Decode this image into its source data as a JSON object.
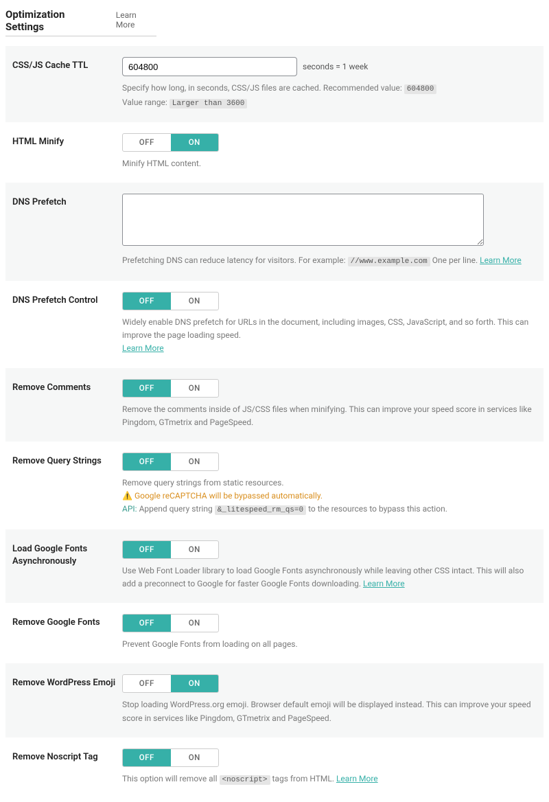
{
  "header": {
    "title": "Optimization Settings",
    "learn_more": "Learn More"
  },
  "settings": {
    "ttl": {
      "label": "CSS/JS Cache TTL",
      "value": "604800",
      "after": "seconds = 1 week",
      "desc1": "Specify how long, in seconds, CSS/JS files are cached. Recommended value:",
      "rec": "604800",
      "desc2": "Value range:",
      "range": "Larger than 3600"
    },
    "html_minify": {
      "label": "HTML Minify",
      "state": "on",
      "desc": "Minify HTML content."
    },
    "dns_prefetch": {
      "label": "DNS Prefetch",
      "value": "",
      "desc1": "Prefetching DNS can reduce latency for visitors. For example:",
      "example": "//www.example.com",
      "desc2": "One per line.",
      "learn": "Learn More"
    },
    "dns_prefetch_control": {
      "label": "DNS Prefetch Control",
      "state": "off",
      "desc": "Widely enable DNS prefetch for URLs in the document, including images, CSS, JavaScript, and so forth. This can improve the page loading speed.",
      "learn": "Learn More"
    },
    "remove_comments": {
      "label": "Remove Comments",
      "state": "off",
      "desc": "Remove the comments inside of JS/CSS files when minifying. This can improve your speed score in services like Pingdom, GTmetrix and PageSpeed."
    },
    "remove_query": {
      "label": "Remove Query Strings",
      "state": "off",
      "desc1": "Remove query strings from static resources.",
      "warn_icon": "⚠️",
      "warn": "Google reCAPTCHA will be bypassed automatically.",
      "api_label": "API:",
      "api_desc1": "Append query string",
      "api_code": "&_litespeed_rm_qs=0",
      "api_desc2": "to the resources to bypass this action."
    },
    "load_gfonts_async": {
      "label": "Load Google Fonts Asynchronously",
      "state": "off",
      "desc": "Use Web Font Loader library to load Google Fonts asynchronously while leaving other CSS intact. This will also add a preconnect to Google for faster Google Fonts downloading.",
      "learn": "Learn More"
    },
    "remove_gfonts": {
      "label": "Remove Google Fonts",
      "state": "off",
      "desc": "Prevent Google Fonts from loading on all pages."
    },
    "remove_emoji": {
      "label": "Remove WordPress Emoji",
      "state": "on",
      "desc": "Stop loading WordPress.org emoji. Browser default emoji will be displayed instead. This can improve your speed score in services like Pingdom, GTmetrix and PageSpeed."
    },
    "remove_noscript": {
      "label": "Remove Noscript Tag",
      "state": "off",
      "desc1": "This option will remove all",
      "code": "<noscript>",
      "desc2": "tags from HTML.",
      "learn": "Learn More"
    }
  },
  "toggle_labels": {
    "off": "OFF",
    "on": "ON"
  }
}
